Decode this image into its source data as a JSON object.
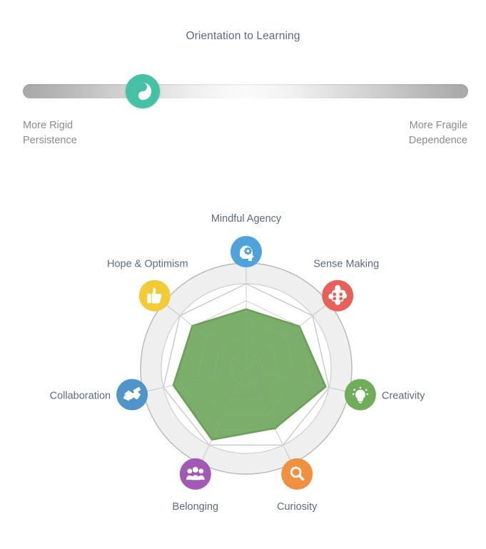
{
  "spectrum": {
    "title": "Orientation to Learning",
    "handle_icon": "yin-yang-icon",
    "handle_color": "#45c1a5",
    "handle_position_pct": 27,
    "left_caption_line1": "More Rigid",
    "left_caption_line2": "Persistence",
    "right_caption_line1": "More Fragile",
    "right_caption_line2": "Dependence"
  },
  "chart_data": {
    "type": "radar",
    "title": "",
    "categories": [
      "Mindful Agency",
      "Sense Making",
      "Creativity",
      "Curiosity",
      "Belonging",
      "Collaboration",
      "Hope & Optimism"
    ],
    "values": [
      0.7,
      0.8,
      0.96,
      0.78,
      0.93,
      0.88,
      0.81
    ],
    "ylim": [
      0,
      1
    ],
    "rings": [
      0.2,
      0.4,
      0.6,
      0.8,
      1.0
    ],
    "grid": true,
    "legend": "none",
    "series": [
      {
        "name": "Orientation to Learning",
        "values": [
          0.7,
          0.8,
          0.96,
          0.78,
          0.93,
          0.88,
          0.81
        ],
        "fill_color": "#74a963",
        "stroke_color": "#6aa055"
      }
    ],
    "axes": [
      {
        "label": "Mindful Agency",
        "value": 0.7,
        "icon": "head-gear-icon",
        "color": "#4fa3dc"
      },
      {
        "label": "Sense Making",
        "value": 0.8,
        "icon": "puzzle-icon",
        "color": "#e8605a"
      },
      {
        "label": "Creativity",
        "value": 0.96,
        "icon": "lightbulb-icon",
        "color": "#6fad5b"
      },
      {
        "label": "Curiosity",
        "value": 0.78,
        "icon": "magnifier-icon",
        "color": "#ef9140"
      },
      {
        "label": "Belonging",
        "value": 0.93,
        "icon": "people-icon",
        "color": "#a259b5"
      },
      {
        "label": "Collaboration",
        "value": 0.88,
        "icon": "handshake-icon",
        "color": "#4f95c9"
      },
      {
        "label": "Hope & Optimism",
        "value": 0.81,
        "icon": "thumbs-up-icon",
        "color": "#f2cb36"
      }
    ],
    "ring_band_color": "#efefef",
    "ring_line_color": "#b6b6b6"
  }
}
